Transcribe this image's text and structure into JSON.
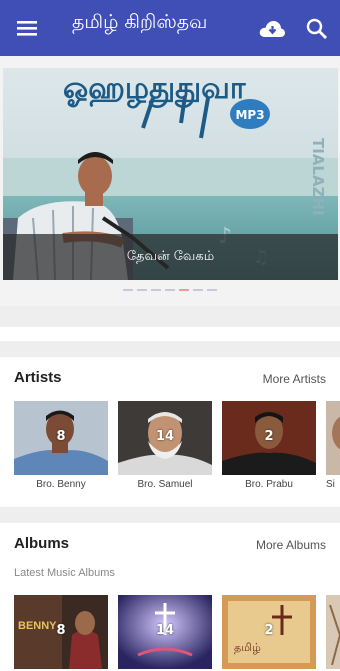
{
  "appbar": {
    "title": "தமிழ் கிறிஸ்தவ",
    "icons": [
      "menu-icon",
      "cloud-download-icon",
      "search-icon"
    ],
    "color": "#3f4fb5"
  },
  "banner": {
    "caption": "தேவன் வேகம்",
    "art_title": "ஓஹழதுதுவா",
    "art_badge": "MP3",
    "art_side": "TIALAZHI",
    "slide_count": 7,
    "active_slide": 4
  },
  "artists": {
    "title": "Artists",
    "more": "More Artists",
    "items": [
      {
        "name": "Bro. Benny",
        "count": "8"
      },
      {
        "name": "Bro. Samuel",
        "count": "14"
      },
      {
        "name": "Bro. Prabu",
        "count": "2"
      },
      {
        "name": "Si",
        "count": ""
      }
    ]
  },
  "albums": {
    "title": "Albums",
    "more": "More Albums",
    "subtitle": "Latest Music Albums",
    "items": [
      {
        "count": "8",
        "art_text": "BENNY"
      },
      {
        "count": "14",
        "art_text": ""
      },
      {
        "count": "2",
        "art_text": "தமிழ்"
      },
      {
        "count": "",
        "art_text": ""
      }
    ]
  }
}
